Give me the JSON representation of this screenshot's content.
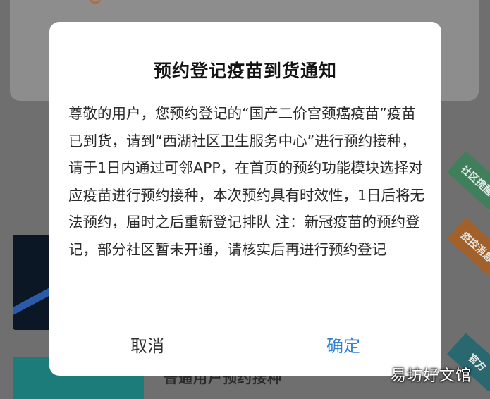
{
  "background": {
    "list_item_text": "普通用户预约接种",
    "ribbons": [
      "社区提醒",
      "疫控消息",
      "官方"
    ]
  },
  "dialog": {
    "title": "预约登记疫苗到货通知",
    "message": "尊敬的用户，您预约登记的“国产二价宫颈癌疫苗”疫苗已到货，请到“西湖社区卫生服务中心”进行预约接种，请于1日内通过可邻APP，在首页的预约功能模块选择对应疫苗进行预约接种，本次预约具有时效性，1日后将无法预约，届时之后重新登记排队 注：新冠疫苗的预约登记，部分社区暂未开通，请核实后再进行预约登记",
    "cancel_label": "取消",
    "confirm_label": "确定"
  },
  "watermark": "易坊好文馆",
  "colors": {
    "confirm": "#2f82d8",
    "overlay": "#6f6f6f",
    "dialog_bg": "#ffffff"
  }
}
